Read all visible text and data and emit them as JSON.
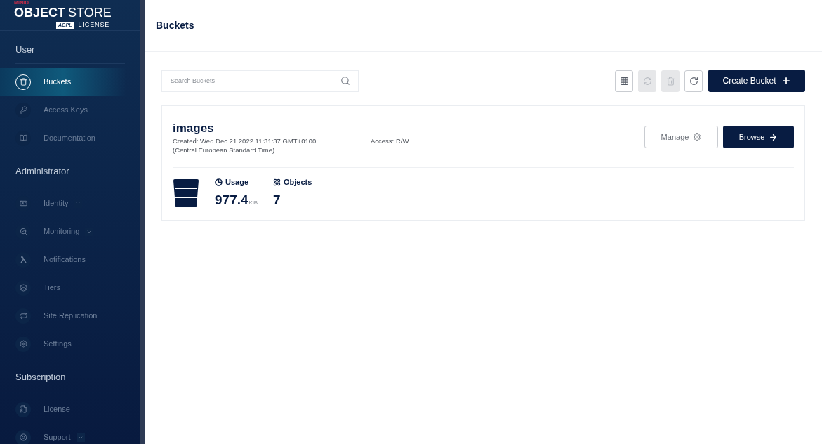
{
  "logo": {
    "brand": "MINIO",
    "product_bold": "OBJECT",
    "product_light": "STORE",
    "badge": "AGPL",
    "license": "LICENSE"
  },
  "sidebar": {
    "sections": [
      {
        "title": "User",
        "items": [
          {
            "label": "Buckets",
            "selected": true,
            "expandable": false
          },
          {
            "label": "Access Keys",
            "selected": false,
            "expandable": false
          },
          {
            "label": "Documentation",
            "selected": false,
            "expandable": false
          }
        ]
      },
      {
        "title": "Administrator",
        "items": [
          {
            "label": "Identity",
            "selected": false,
            "expandable": true
          },
          {
            "label": "Monitoring",
            "selected": false,
            "expandable": true
          },
          {
            "label": "Notifications",
            "selected": false,
            "expandable": false
          },
          {
            "label": "Tiers",
            "selected": false,
            "expandable": false
          },
          {
            "label": "Site Replication",
            "selected": false,
            "expandable": false
          },
          {
            "label": "Settings",
            "selected": false,
            "expandable": false
          }
        ]
      },
      {
        "title": "Subscription",
        "items": [
          {
            "label": "License",
            "selected": false,
            "expandable": false
          },
          {
            "label": "Support",
            "selected": false,
            "expandable": true
          }
        ]
      }
    ]
  },
  "page_title": "Buckets",
  "search": {
    "placeholder": "Search Buckets"
  },
  "toolbar": [
    {
      "kind": "grid",
      "disabled": false
    },
    {
      "kind": "replicate",
      "disabled": true
    },
    {
      "kind": "delete",
      "disabled": true
    },
    {
      "kind": "refresh",
      "disabled": false
    }
  ],
  "create_button": "Create Bucket",
  "buckets": [
    {
      "name": "images",
      "created": "Created: Wed Dec 21 2022 11:31:37 GMT+0100",
      "timezone": "(Central European Standard Time)",
      "access": "Access: R/W",
      "manage": "Manage",
      "browse": "Browse",
      "usage_label": "Usage",
      "usage_value": "977.4",
      "usage_unit": "KiB",
      "objects_label": "Objects",
      "objects_value": "7"
    }
  ]
}
